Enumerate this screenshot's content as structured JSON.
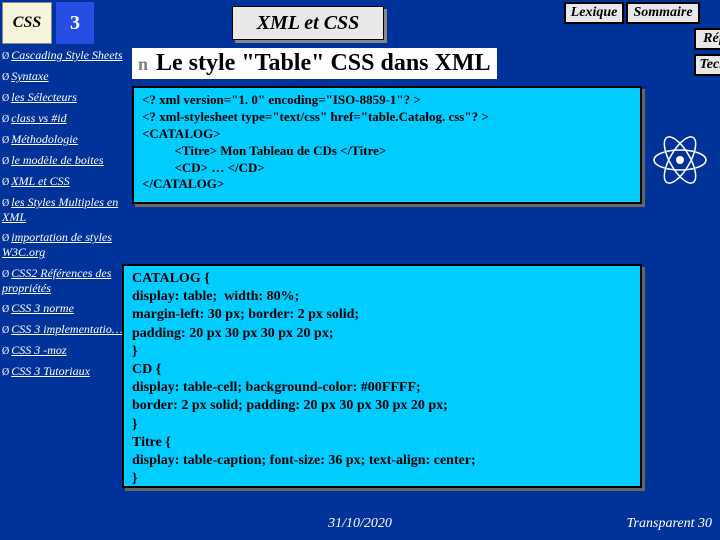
{
  "logo": {
    "text1": "CSS",
    "text2": "3"
  },
  "title": "XML et CSS",
  "buttons": {
    "lexique": "Lexique",
    "sommaire": "Sommaire",
    "refs": "Réfs",
    "techs": "Techs"
  },
  "heading": {
    "bullet": "n",
    "text": "Le style \"Table\" CSS dans XML"
  },
  "sidebar": {
    "items": [
      "Cascading Style Sheets",
      "Syntaxe",
      "les Sélecteurs",
      "class vs #id",
      "Méthodologie",
      "le modèle de boites",
      "XML et CSS",
      "les Styles Multiples en XML",
      "importation de styles W3C.org",
      "CSS2 Références des propriétés",
      "CSS 3 norme",
      "CSS 3 implementatio…",
      "CSS 3 -moz",
      "CSS 3 Tutoriaux"
    ]
  },
  "code1": "<? xml version=\"1. 0\" encoding=\"ISO-8859-1\"? >\n<? xml-stylesheet type=\"text/css\" href=\"table.Catalog. css\"? >\n<CATALOG>\n          <Titre> Mon Tableau de CDs </Titre>\n          <CD> … </CD>\n</CATALOG>",
  "code2": "CATALOG {\ndisplay: table;  width: 80%;\nmargin-left: 30 px; border: 2 px solid;\npadding: 20 px 30 px 30 px 20 px;\n}\nCD {\ndisplay: table-cell; background-color: #00FFFF;\nborder: 2 px solid; padding: 20 px 30 px 30 px 20 px;\n}\nTitre {\ndisplay: table-caption; font-size: 36 px; text-align: center;\n}",
  "footer": {
    "date": "31/10/2020",
    "page": "Transparent 30"
  }
}
